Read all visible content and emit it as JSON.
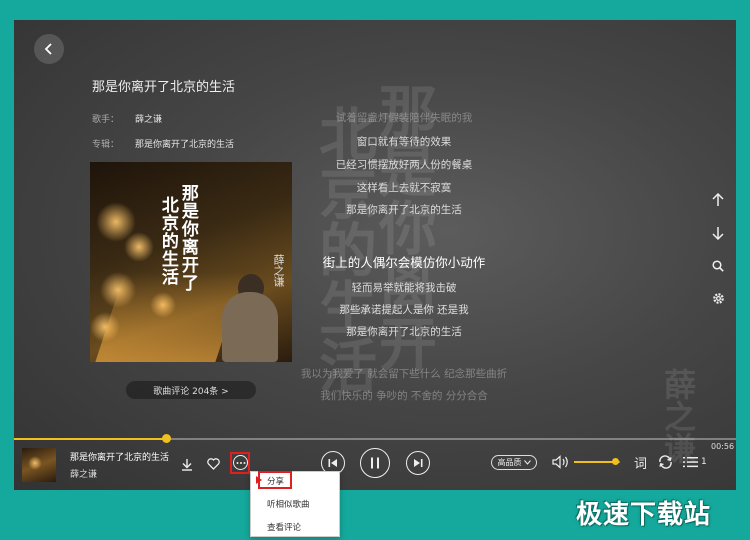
{
  "song": {
    "title": "那是你离开了北京的生活",
    "artist_label": "歌手：",
    "artist": "薛之谦",
    "album_label": "专辑：",
    "album": "那是你离开了北京的生活"
  },
  "cover": {
    "title_line1": "那是你离开了",
    "title_line2": "北京的生活",
    "artist_text": "薛之谦"
  },
  "comments_button": "歌曲评论 204条 >",
  "background_art": {
    "col1": "北京的生活",
    "col2": "那是你离开",
    "col3": "薛之谦"
  },
  "lyrics": [
    {
      "text": "试着留盏灯假装陪伴失眠的我",
      "state": "dim"
    },
    {
      "text": "窗口就有等待的效果",
      "state": "normal"
    },
    {
      "text": "已经习惯摆放好两人份的餐桌",
      "state": "normal"
    },
    {
      "text": "这样看上去就不寂寞",
      "state": "normal"
    },
    {
      "text": "那是你离开了北京的生活",
      "state": "normal"
    },
    {
      "text": "街上的人偶尔会模仿你小动作",
      "state": "current"
    },
    {
      "text": "轻而易举就能将我击破",
      "state": "normal"
    },
    {
      "text": "那些承诺提起人是你 还是我",
      "state": "normal"
    },
    {
      "text": "那是你离开了北京的生活",
      "state": "normal"
    },
    {
      "text": "我以为我爱了 就会留下些什么 纪念那些曲折",
      "state": "dim"
    },
    {
      "text": "我们快乐的 争吵的 不舍的 分分合合",
      "state": "dim"
    }
  ],
  "player": {
    "time": "00:56",
    "progress": 0.21,
    "volume": 0.9,
    "quality": "高品质",
    "lyric_toggle": "词",
    "playlist_count": "1",
    "now_playing_title": "那是你离开了北京的生活",
    "now_playing_artist": "薛之谦"
  },
  "more_menu": {
    "items": [
      "分享",
      "听相似歌曲",
      "查看评论"
    ]
  },
  "watermark": "极速下载站",
  "colors": {
    "accent": "#f2c01c",
    "highlight": "#e02020",
    "page_bg": "#14a99c"
  },
  "icons": [
    "back-arrow-icon",
    "scroll-up-icon",
    "scroll-down-icon",
    "search-icon",
    "gear-icon",
    "download-icon",
    "heart-icon",
    "more-icon",
    "prev-icon",
    "pause-icon",
    "next-icon",
    "volume-icon",
    "repeat-icon",
    "playlist-icon"
  ]
}
